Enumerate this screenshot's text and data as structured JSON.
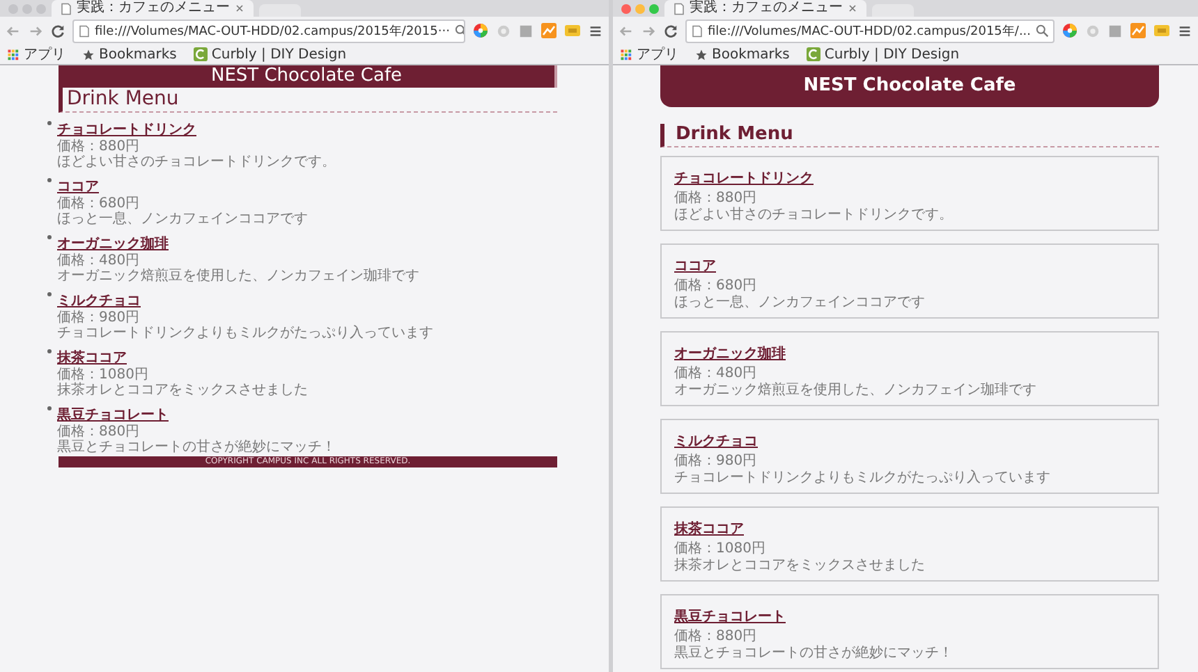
{
  "windows": [
    {
      "focused": false,
      "tab_title": "実践：カフェのメニュー",
      "url": "file:///Volumes/MAC-OUT-HDD/02.campus/2015年/2015···",
      "bookmarks": [
        {
          "kind": "apps",
          "label": "アプリ"
        },
        {
          "kind": "folder",
          "label": "Bookmarks"
        },
        {
          "kind": "site",
          "label": "Curbly | DIY Design"
        }
      ],
      "page": {
        "kind": "plain",
        "site_title": "NEST Chocolate Cafe",
        "heading": "Drink Menu",
        "items": [
          {
            "name": "チョコレートドリンク",
            "price": "価格：880円",
            "description": "ほどよい甘さのチョコレートドリンクです。"
          },
          {
            "name": "ココア",
            "price": "価格：680円",
            "description": "ほっと一息、ノンカフェインココアです"
          },
          {
            "name": "オーガニック珈琲",
            "price": "価格：480円",
            "description": "オーガニック焙煎豆を使用した、ノンカフェイン珈琲です"
          },
          {
            "name": "ミルクチョコ",
            "price": "価格：980円",
            "description": "チョコレートドリンクよりもミルクがたっぷり入っています"
          },
          {
            "name": "抹茶ココア",
            "price": "価格：1080円",
            "description": "抹茶オレとココアをミックスさせました"
          },
          {
            "name": "黒豆チョコレート",
            "price": "価格：880円",
            "description": "黒豆とチョコレートの甘さが絶妙にマッチ！"
          }
        ],
        "footer": "COPYRIGHT CAMPUS INC ALL RIGHTS RESERVED."
      }
    },
    {
      "focused": true,
      "tab_title": "実践：カフェのメニュー",
      "url": "file:///Volumes/MAC-OUT-HDD/02.campus/2015年/...",
      "bookmarks": [
        {
          "kind": "apps",
          "label": "アプリ"
        },
        {
          "kind": "folder",
          "label": "Bookmarks"
        },
        {
          "kind": "site",
          "label": "Curbly | DIY Design"
        }
      ],
      "page": {
        "kind": "cards",
        "site_title": "NEST Chocolate Cafe",
        "heading": "Drink Menu",
        "items": [
          {
            "name": "チョコレートドリンク",
            "price": "価格：880円",
            "description": "ほどよい甘さのチョコレートドリンクです。"
          },
          {
            "name": "ココア",
            "price": "価格：680円",
            "description": "ほっと一息、ノンカフェインココアです"
          },
          {
            "name": "オーガニック珈琲",
            "price": "価格：480円",
            "description": "オーガニック焙煎豆を使用した、ノンカフェイン珈琲です"
          },
          {
            "name": "ミルクチョコ",
            "price": "価格：980円",
            "description": "チョコレートドリンクよりもミルクがたっぷり入っています"
          },
          {
            "name": "抹茶ココア",
            "price": "価格：1080円",
            "description": "抹茶オレとココアをミックスさせました"
          },
          {
            "name": "黒豆チョコレート",
            "price": "価格：880円",
            "description": "黒豆とチョコレートの甘さが絶妙にマッチ！"
          }
        ]
      }
    }
  ]
}
